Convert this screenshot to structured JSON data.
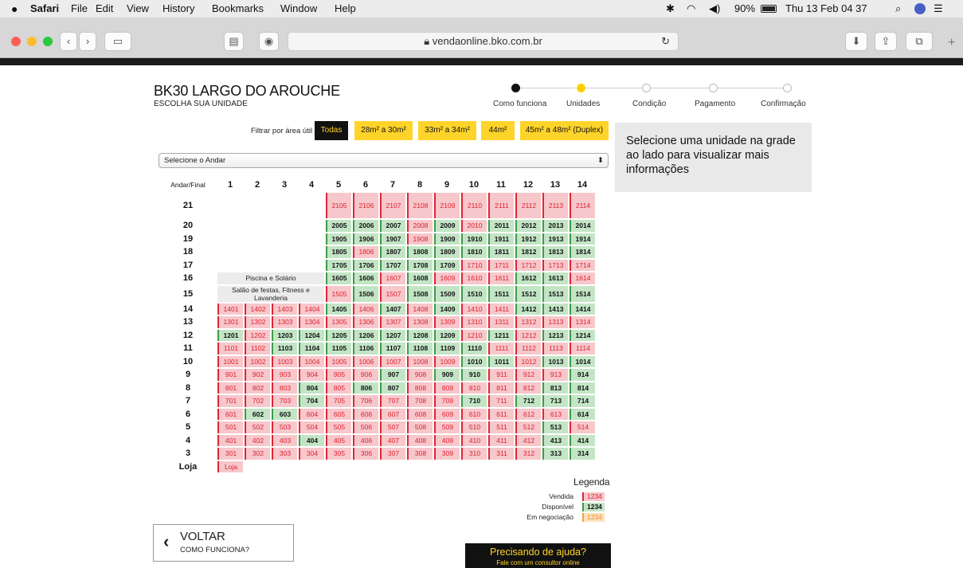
{
  "menubar": {
    "apple": "",
    "app": "Safari",
    "items": [
      "File",
      "Edit",
      "View",
      "History",
      "Bookmarks",
      "Window",
      "Help"
    ],
    "battery": "90%",
    "clock": "Thu 13 Feb  04 37"
  },
  "browser": {
    "url": "vendaonline.bko.com.br"
  },
  "header": {
    "title": "BK30 LARGO DO AROUCHE",
    "subtitle": "ESCOLHA SUA UNIDADE"
  },
  "steps": [
    {
      "label": "Como funciona"
    },
    {
      "label": "Unidades"
    },
    {
      "label": "Condição"
    },
    {
      "label": "Pagamento"
    },
    {
      "label": "Confirmação"
    }
  ],
  "filter": {
    "label": "Filtrar por área útil",
    "options": [
      "Todas",
      "28m² a 30m²",
      "33m² a 34m²",
      "44m²",
      "45m² a 48m² (Duplex)"
    ]
  },
  "floor_select": {
    "value": "Selecione o Andar"
  },
  "info_panel": {
    "text": "Selecione uma unidade na grade ao lado para visualizar mais informações"
  },
  "grid": {
    "corner": "Andar/Final",
    "columns": [
      "1",
      "2",
      "3",
      "4",
      "5",
      "6",
      "7",
      "8",
      "9",
      "10",
      "11",
      "12",
      "13",
      "14"
    ],
    "rows": [
      {
        "floor": "21",
        "start": 5,
        "units": [
          "2105",
          "2106",
          "2107",
          "2108",
          "2109",
          "2110",
          "2111",
          "2112",
          "2113",
          "2114"
        ],
        "status": "ssssssssss"
      },
      {
        "floor": "20",
        "start": 5,
        "units": [
          "2005",
          "2006",
          "2007",
          "2008",
          "2009",
          "2010",
          "2011",
          "2012",
          "2013",
          "2014"
        ],
        "status": "aaasasaaaa"
      },
      {
        "floor": "19",
        "start": 5,
        "units": [
          "1905",
          "1906",
          "1907",
          "1908",
          "1909",
          "1910",
          "1911",
          "1912",
          "1913",
          "1914"
        ],
        "status": "aaasaaaaaa"
      },
      {
        "floor": "18",
        "start": 5,
        "units": [
          "1805",
          "1806",
          "1807",
          "1808",
          "1809",
          "1810",
          "1811",
          "1812",
          "1813",
          "1814"
        ],
        "status": "asaaaaaaaa"
      },
      {
        "floor": "17",
        "start": 5,
        "units": [
          "1705",
          "1706",
          "1707",
          "1708",
          "1709",
          "1710",
          "1711",
          "1712",
          "1713",
          "1714"
        ],
        "status": "aaaaasssss"
      },
      {
        "floor": "16",
        "amenity": "Piscina e Solário",
        "start": 5,
        "units": [
          "1605",
          "1606",
          "1607",
          "1608",
          "1609",
          "1610",
          "1611",
          "1612",
          "1613",
          "1614"
        ],
        "status": "aasasssaas"
      },
      {
        "floor": "15",
        "amenity": "Salão de festas, Fitness e Lavanderia",
        "start": 5,
        "units": [
          "1505",
          "1506",
          "1507",
          "1508",
          "1509",
          "1510",
          "1511",
          "1512",
          "1513",
          "1514"
        ],
        "status": "sasaaaaaaa"
      },
      {
        "floor": "14",
        "start": 1,
        "units": [
          "1401",
          "1402",
          "1403",
          "1404",
          "1405",
          "1406",
          "1407",
          "1408",
          "1409",
          "1410",
          "1411",
          "1412",
          "1413",
          "1414"
        ],
        "status": "ssssasasassaaa"
      },
      {
        "floor": "13",
        "start": 1,
        "units": [
          "1301",
          "1302",
          "1303",
          "1304",
          "1305",
          "1306",
          "1307",
          "1308",
          "1309",
          "1310",
          "1311",
          "1312",
          "1313",
          "1314"
        ],
        "status": "ssssssssssssss"
      },
      {
        "floor": "12",
        "start": 1,
        "units": [
          "1201",
          "1202",
          "1203",
          "1204",
          "1205",
          "1206",
          "1207",
          "1208",
          "1209",
          "1210",
          "1211",
          "1212",
          "1213",
          "1214"
        ],
        "status": "asaaaaaaasasaa"
      },
      {
        "floor": "11",
        "start": 1,
        "units": [
          "1101",
          "1102",
          "1103",
          "1104",
          "1105",
          "1106",
          "1107",
          "1108",
          "1109",
          "1110",
          "1111",
          "1112",
          "1113",
          "1114"
        ],
        "status": "ssaaaaaaaassss"
      },
      {
        "floor": "10",
        "start": 1,
        "units": [
          "1001",
          "1002",
          "1003",
          "1004",
          "1005",
          "1006",
          "1007",
          "1008",
          "1009",
          "1010",
          "1011",
          "1012",
          "1013",
          "1014"
        ],
        "status": "sssssssssaasaa"
      },
      {
        "floor": "9",
        "start": 1,
        "units": [
          "901",
          "902",
          "903",
          "904",
          "905",
          "906",
          "907",
          "908",
          "909",
          "910",
          "911",
          "912",
          "913",
          "914"
        ],
        "status": "ssssssasaasssaa"
      },
      {
        "floor": "8",
        "start": 1,
        "units": [
          "801",
          "802",
          "803",
          "804",
          "805",
          "806",
          "807",
          "808",
          "809",
          "810",
          "811",
          "812",
          "813",
          "814"
        ],
        "status": "sssasaasssssaa"
      },
      {
        "floor": "7",
        "start": 1,
        "units": [
          "701",
          "702",
          "703",
          "704",
          "705",
          "706",
          "707",
          "708",
          "709",
          "710",
          "711",
          "712",
          "713",
          "714"
        ],
        "status": "sssasssssasaaa"
      },
      {
        "floor": "6",
        "start": 1,
        "units": [
          "601",
          "602",
          "603",
          "604",
          "605",
          "606",
          "607",
          "608",
          "609",
          "610",
          "611",
          "612",
          "613",
          "614"
        ],
        "status": "saassssssssssas"
      },
      {
        "floor": "5",
        "start": 1,
        "units": [
          "501",
          "502",
          "503",
          "504",
          "505",
          "506",
          "507",
          "508",
          "509",
          "510",
          "511",
          "512",
          "513",
          "514"
        ],
        "status": "ssssssssssssas"
      },
      {
        "floor": "4",
        "start": 1,
        "units": [
          "401",
          "402",
          "403",
          "404",
          "405",
          "406",
          "407",
          "408",
          "409",
          "410",
          "411",
          "412",
          "413",
          "414"
        ],
        "status": "sssassssssssaa"
      },
      {
        "floor": "3",
        "start": 1,
        "units": [
          "301",
          "302",
          "303",
          "304",
          "305",
          "306",
          "307",
          "308",
          "309",
          "310",
          "311",
          "312",
          "313",
          "314"
        ],
        "status": "ssssssssssssaa"
      },
      {
        "floor": "Loja",
        "start": 1,
        "units": [
          "Loja"
        ],
        "status": "s"
      }
    ]
  },
  "legend": {
    "title": "Legenda",
    "items": [
      {
        "label": "Vendida",
        "sample": "1234",
        "color": "#e02535"
      },
      {
        "label": "Disponível",
        "sample": "1234",
        "color": "#3f9a48"
      },
      {
        "label": "Em negociação",
        "sample": "1234",
        "color": "#f4a340"
      }
    ]
  },
  "back": {
    "label": "VOLTAR",
    "sub": "COMO FUNCIONA?"
  },
  "help": {
    "title": "Precisando de ajuda?",
    "sub": "Fale com um consultor online"
  }
}
